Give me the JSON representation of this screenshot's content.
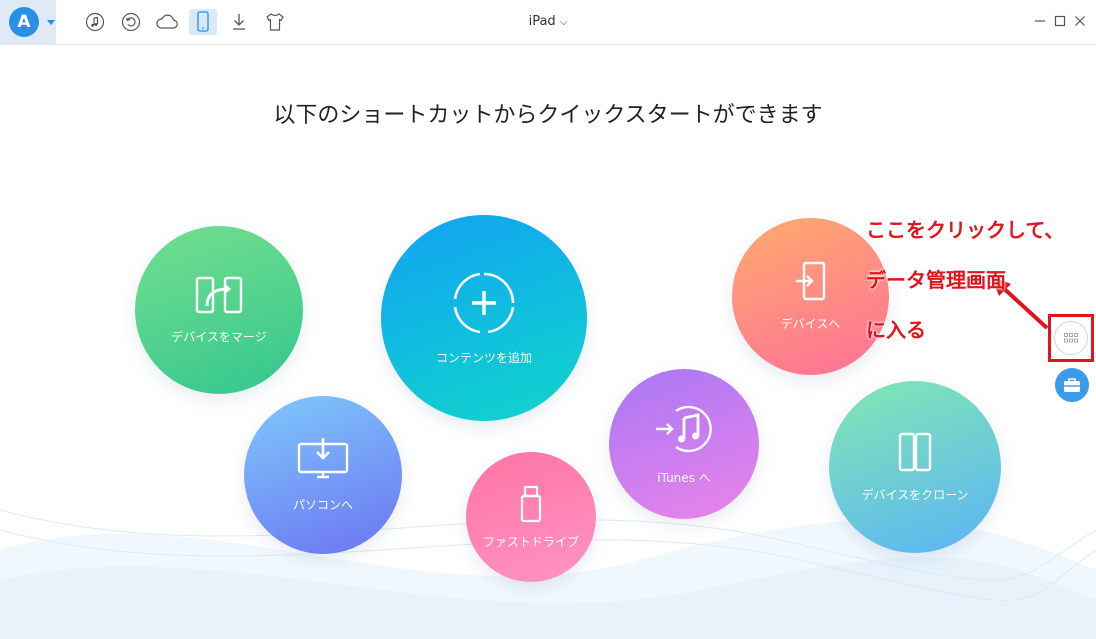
{
  "app": {
    "logo_letter": "A",
    "accent": "#2a8fe6"
  },
  "toolbar": {
    "tools": [
      {
        "icon": "music-note-icon"
      },
      {
        "icon": "history-icon"
      },
      {
        "icon": "cloud-icon"
      },
      {
        "icon": "phone-device-icon",
        "active": true
      },
      {
        "icon": "download-icon"
      },
      {
        "icon": "tshirt-icon"
      }
    ],
    "device_name": "iPad",
    "device_caret": "⌵"
  },
  "main": {
    "headline": "以下のショートカットからクイックスタートができます"
  },
  "shortcuts": {
    "merge": {
      "label": "デバイスをマージ",
      "colors": [
        "#74df8d",
        "#33c68f"
      ]
    },
    "add_content": {
      "label": "コンテンツを追加",
      "colors": [
        "#12a2f3",
        "#0fd6cb"
      ]
    },
    "to_pc": {
      "label": "パソコンへ",
      "colors": [
        "#7fc9fb",
        "#6b74f2"
      ]
    },
    "fast_drive": {
      "label": "ファストドライブ",
      "colors": [
        "#ff74a2",
        "#ff94c6"
      ]
    },
    "to_itunes": {
      "label": "iTunes へ",
      "colors": [
        "#a977f5",
        "#ea84ea"
      ]
    },
    "to_device": {
      "label": "デバイスへ",
      "colors": [
        "#ffaa6e",
        "#ff7197"
      ]
    },
    "clone": {
      "label": "デバイスをクローン",
      "colors": [
        "#82e8b3",
        "#5bb3f5"
      ]
    }
  },
  "annotation": {
    "line1": "ここをクリックして、",
    "line2": "データ管理画面",
    "line3": "に入る",
    "color": "#e0141a"
  }
}
